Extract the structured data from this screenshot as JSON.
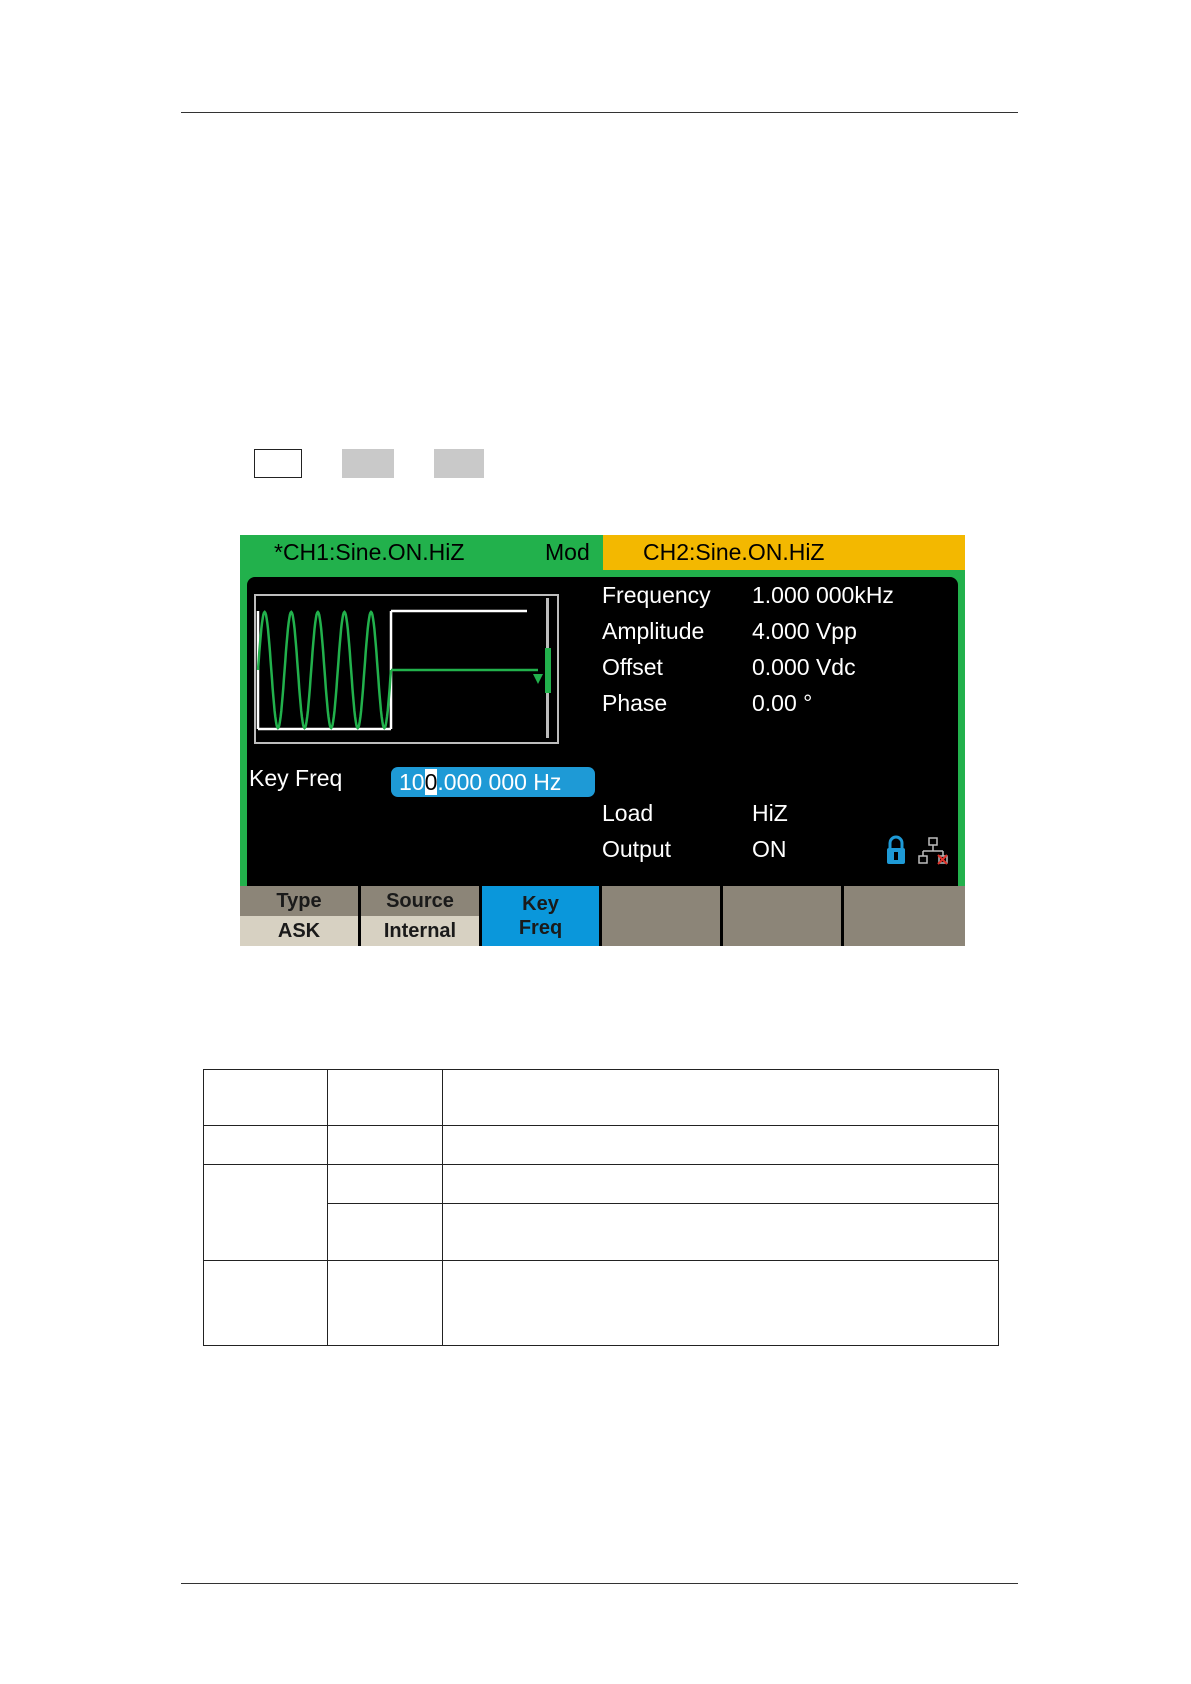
{
  "screen": {
    "ch1_title": "*CH1:Sine.ON.HiZ",
    "mod_label": "Mod",
    "ch2_title": "CH2:Sine.ON.HiZ",
    "params": [
      {
        "label": "Frequency",
        "value": "1.000 000kHz"
      },
      {
        "label": "Amplitude",
        "value": "4.000 Vpp"
      },
      {
        "label": "Offset",
        "value": "0.000 Vdc"
      },
      {
        "label": "Phase",
        "value": "0.00 °"
      }
    ],
    "load": {
      "label": "Load",
      "value": "HiZ"
    },
    "output": {
      "label": "Output",
      "value": "ON"
    },
    "key_freq": {
      "label": "Key Freq",
      "value_before": "10",
      "value_cursor": "0",
      "value_after": ".000 000 Hz"
    },
    "icons": [
      "lock-icon",
      "network-icon"
    ],
    "softkeys": [
      {
        "top": "Type",
        "bottom": "ASK"
      },
      {
        "top": "Source",
        "bottom": "Internal"
      },
      {
        "top": "Key",
        "bottom": "Freq",
        "selected": true
      },
      {
        "top": "",
        "bottom": ""
      },
      {
        "top": "",
        "bottom": ""
      },
      {
        "top": "",
        "bottom": ""
      }
    ],
    "colors": {
      "ch1": "#22b14c",
      "ch2": "#f3b800",
      "selected_softkey": "#0a97db",
      "waveform": "#22b14c"
    }
  }
}
